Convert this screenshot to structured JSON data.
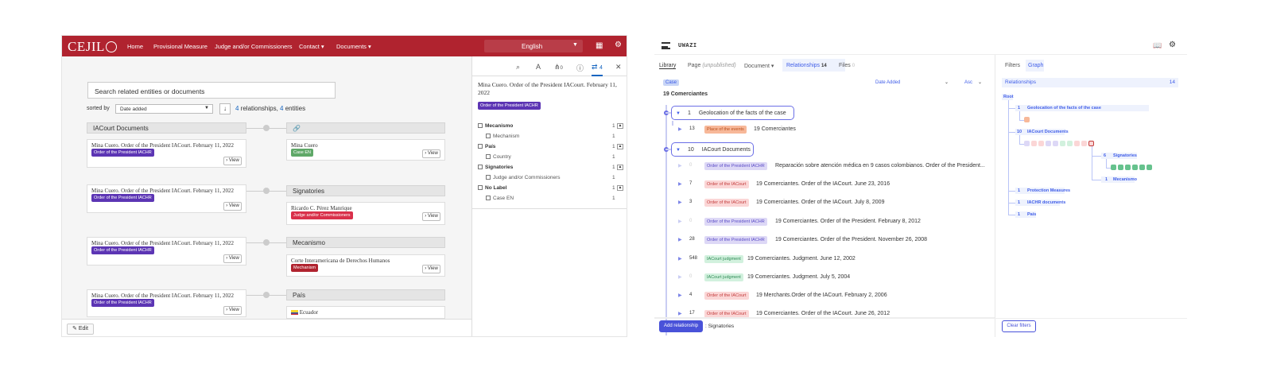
{
  "cejil": {
    "logo": "CEJIL",
    "nav": [
      "Home",
      "Provisional Measure",
      "Judge and/or Commissioners",
      "Contact ▾",
      "Documents ▾"
    ],
    "language": "English",
    "search_placeholder": "Search related entities or documents",
    "sort_label": "sorted by",
    "sort_value": "Date added",
    "rel_count_num": "4",
    "rel_count_mid": " relationships, ",
    "ent_count_num": "4",
    "ent_count_tail": " entities",
    "groups": [
      {
        "left_header": "IACourt Documents",
        "right_header": "",
        "doc_title": "Mina Cuero. Order of the President IACourt. February 11, 2022",
        "doc_badge": "Order of the President IACHR",
        "ent_title": "Mina Cuero",
        "ent_badge": "Case EN"
      },
      {
        "left_header": "",
        "right_header": "Signatories",
        "doc_title": "Mina Cuero. Order of the President IACourt. February 11, 2022",
        "doc_badge": "Order of the President IACHR",
        "ent_title": "Ricardo C. Pérez Manrique",
        "ent_badge": "Judge and/or Commissioners"
      },
      {
        "left_header": "",
        "right_header": "Mecanismo",
        "doc_title": "Mina Cuero. Order of the President IACourt. February 11, 2022",
        "doc_badge": "Order of the President IACHR",
        "ent_title": "Corte Interamericana de Derechos Humanos",
        "ent_badge": "Mechanism"
      },
      {
        "left_header": "",
        "right_header": "País",
        "doc_title": "Mina Cuero. Order of the President IACourt. February 11, 2022",
        "doc_badge": "Order of the President IACHR",
        "ent_title": "Ecuador",
        "ent_badge": ""
      }
    ],
    "view_label": "View",
    "edit_label": "Edit",
    "side": {
      "count": "4",
      "relations_count": "0",
      "title": "Mina Cuero. Order of the President IACourt. February 11, 2022",
      "badge": "Order of the President IACHR",
      "filters": [
        {
          "label": "Mecanismo",
          "count": "1",
          "bold": true
        },
        {
          "label": "Mechanism",
          "count": "1",
          "bold": false
        },
        {
          "label": "País",
          "count": "1",
          "bold": true
        },
        {
          "label": "Country",
          "count": "1",
          "bold": false
        },
        {
          "label": "Signatories",
          "count": "1",
          "bold": true
        },
        {
          "label": "Judge and/or Commissioners",
          "count": "1",
          "bold": false
        },
        {
          "label": "No Label",
          "count": "1",
          "bold": true
        },
        {
          "label": "Case EN",
          "count": "1",
          "bold": false
        }
      ]
    }
  },
  "uwazi": {
    "logo": "UWAZI",
    "tabs": [
      {
        "label": "Library",
        "active": true
      },
      {
        "label": "Page",
        "sub": "(unpublished)"
      },
      {
        "label": "Document ▾"
      },
      {
        "label": "Relationships",
        "count": "14"
      },
      {
        "label": "Files",
        "count": "0"
      }
    ],
    "case_badge": "Case",
    "sort_value": "Date Added",
    "order_value": "Asc",
    "entity_title": "19 Comerciantes",
    "groups": [
      {
        "count": "1",
        "label": "Geolocation of the facts of the case"
      },
      {
        "count": "10",
        "label": "IACourt Documents"
      }
    ],
    "rows": [
      {
        "n": "13",
        "badge": "Place of the events",
        "badge_color": "#f3a073",
        "badge_bg": "#f7b899",
        "text": "19 Comerciantes",
        "dim": false
      },
      {
        "n": "0",
        "badge": "Order of the President IACHR",
        "badge_color": "#5a4bc7",
        "badge_bg": "#ddd8f6",
        "text": "Reparación sobre atención médica en 9 casos colombianos. Order of the President...",
        "dim": true
      },
      {
        "n": "7",
        "badge": "Order of the IACourt",
        "badge_color": "#c33d3d",
        "badge_bg": "#fbd6d6",
        "text": "19 Comerciantes. Order of the IACourt. June 23, 2016",
        "dim": false
      },
      {
        "n": "3",
        "badge": "Order of the IACourt",
        "badge_color": "#c33d3d",
        "badge_bg": "#fbd6d6",
        "text": "19 Comerciantes. Order of the IACourt. July 8, 2009",
        "dim": false
      },
      {
        "n": "0",
        "badge": "Order of the President IACHR",
        "badge_color": "#5a4bc7",
        "badge_bg": "#ddd8f6",
        "text": "19 Comerciantes. Order of the President. February 8, 2012",
        "dim": true
      },
      {
        "n": "28",
        "badge": "Order of the President IACHR",
        "badge_color": "#5a4bc7",
        "badge_bg": "#ddd8f6",
        "text": "19 Comerciantes. Order of the President. November 26, 2008",
        "dim": false
      },
      {
        "n": "548",
        "badge": "IACourt judgment",
        "badge_color": "#2e8a55",
        "badge_bg": "#d2f1de",
        "text": "19 Comerciantes. Judgment. June 12, 2002",
        "dim": false
      },
      {
        "n": "0",
        "badge": "IACourt judgment",
        "badge_color": "#2e8a55",
        "badge_bg": "#d2f1de",
        "text": "19 Comerciantes. Judgment. July 5, 2004",
        "dim": true
      },
      {
        "n": "4",
        "badge": "Order of the IACourt",
        "badge_color": "#c33d3d",
        "badge_bg": "#fbd6d6",
        "text": "19 Merchants.Order of the IACourt. February 2, 2006",
        "dim": false
      },
      {
        "n": "17",
        "badge": "Order of the IACourt",
        "badge_color": "#c33d3d",
        "badge_bg": "#fbd6d6",
        "text": "19 Comerciantes. Order of the IACourt. June 26, 2012",
        "dim": false
      }
    ],
    "add_relationship": "Add relationship",
    "add_label": ": Signatories",
    "filters_tab": "Filters",
    "graph_tab": "Graph",
    "relationships_label": "Relationships",
    "relationships_count": "14",
    "graph": {
      "root": "Root",
      "nodes": [
        {
          "n": "1",
          "label": "Geolocation of the facts of the case"
        },
        {
          "n": "10",
          "label": "IACourt Documents"
        },
        {
          "n": "6",
          "label": "Signatories"
        },
        {
          "n": "1",
          "label": "Mecanismo"
        },
        {
          "n": "1",
          "label": "Protection Measures"
        },
        {
          "n": "1",
          "label": "IACHR documents"
        },
        {
          "n": "1",
          "label": "País"
        }
      ]
    },
    "clear_filters": "Clear filters"
  }
}
